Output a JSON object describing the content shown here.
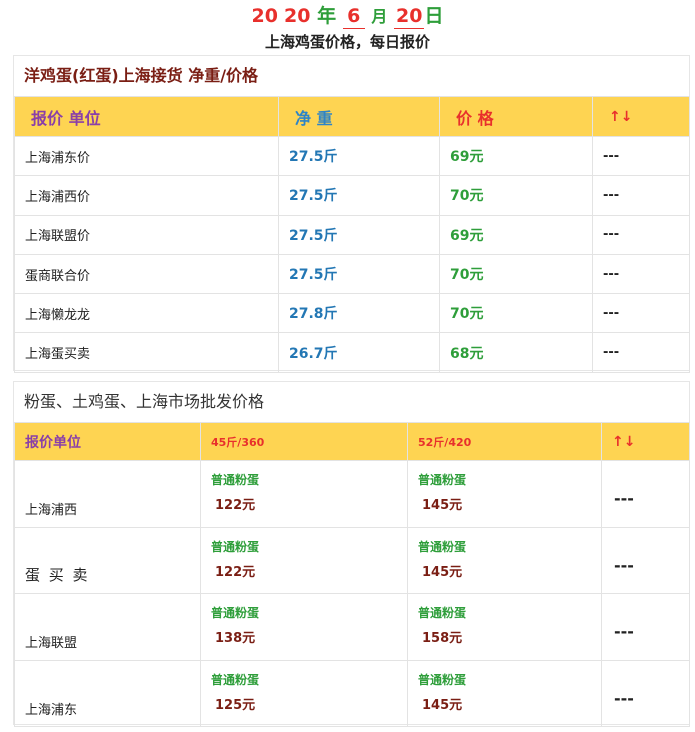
{
  "header": {
    "year_a": "20",
    "year_b": "20",
    "year_char": "年",
    "month": "6",
    "month_char": "月",
    "day": "20",
    "day_char": "日",
    "subtitle": "上海鸡蛋价格，每日报价"
  },
  "section1": {
    "title": "洋鸡蛋(红蛋)上海接货 净重/价格",
    "headers": {
      "unit": "报价 单位",
      "weight": "净 重",
      "price": "价 格",
      "sort": "↑↓"
    },
    "rows": [
      {
        "name": "上海浦东价",
        "weight": "27.5斤",
        "price": "69元",
        "dash": "---"
      },
      {
        "name": "上海浦西价",
        "weight": "27.5斤",
        "price": "70元",
        "dash": "---"
      },
      {
        "name": "上海联盟价",
        "weight": "27.5斤",
        "price": "69元",
        "dash": "---"
      },
      {
        "name": "蛋商联合价",
        "weight": "27.5斤",
        "price": "70元",
        "dash": "---"
      },
      {
        "name": "上海懒龙龙",
        "weight": "27.8斤",
        "price": "70元",
        "dash": "---"
      },
      {
        "name": "上海蛋买卖",
        "weight": "26.7斤",
        "price": "68元",
        "dash": "---"
      }
    ]
  },
  "section2": {
    "title": "粉蛋、土鸡蛋、上海市场批发价格",
    "headers": {
      "unit": "报价单位",
      "spec1": "45斤/360",
      "spec2": "52斤/420",
      "sort": "↑↓"
    },
    "rows": [
      {
        "name": "上海浦西",
        "kind1": "普通粉蛋",
        "price1": "122元",
        "kind2": "普通粉蛋",
        "price2": "145元",
        "dash": "---"
      },
      {
        "name": "蛋 买 卖",
        "kind1": "普通粉蛋",
        "price1": "122元",
        "kind2": "普通粉蛋",
        "price2": "145元",
        "dash": "---"
      },
      {
        "name": "上海联盟",
        "kind1": "普通粉蛋",
        "price1": "138元",
        "kind2": "普通粉蛋",
        "price2": "158元",
        "dash": "---"
      },
      {
        "name": "上海浦东",
        "kind1": "普通粉蛋",
        "price1": "125元",
        "kind2": "普通粉蛋",
        "price2": "145元",
        "dash": "---"
      }
    ]
  }
}
